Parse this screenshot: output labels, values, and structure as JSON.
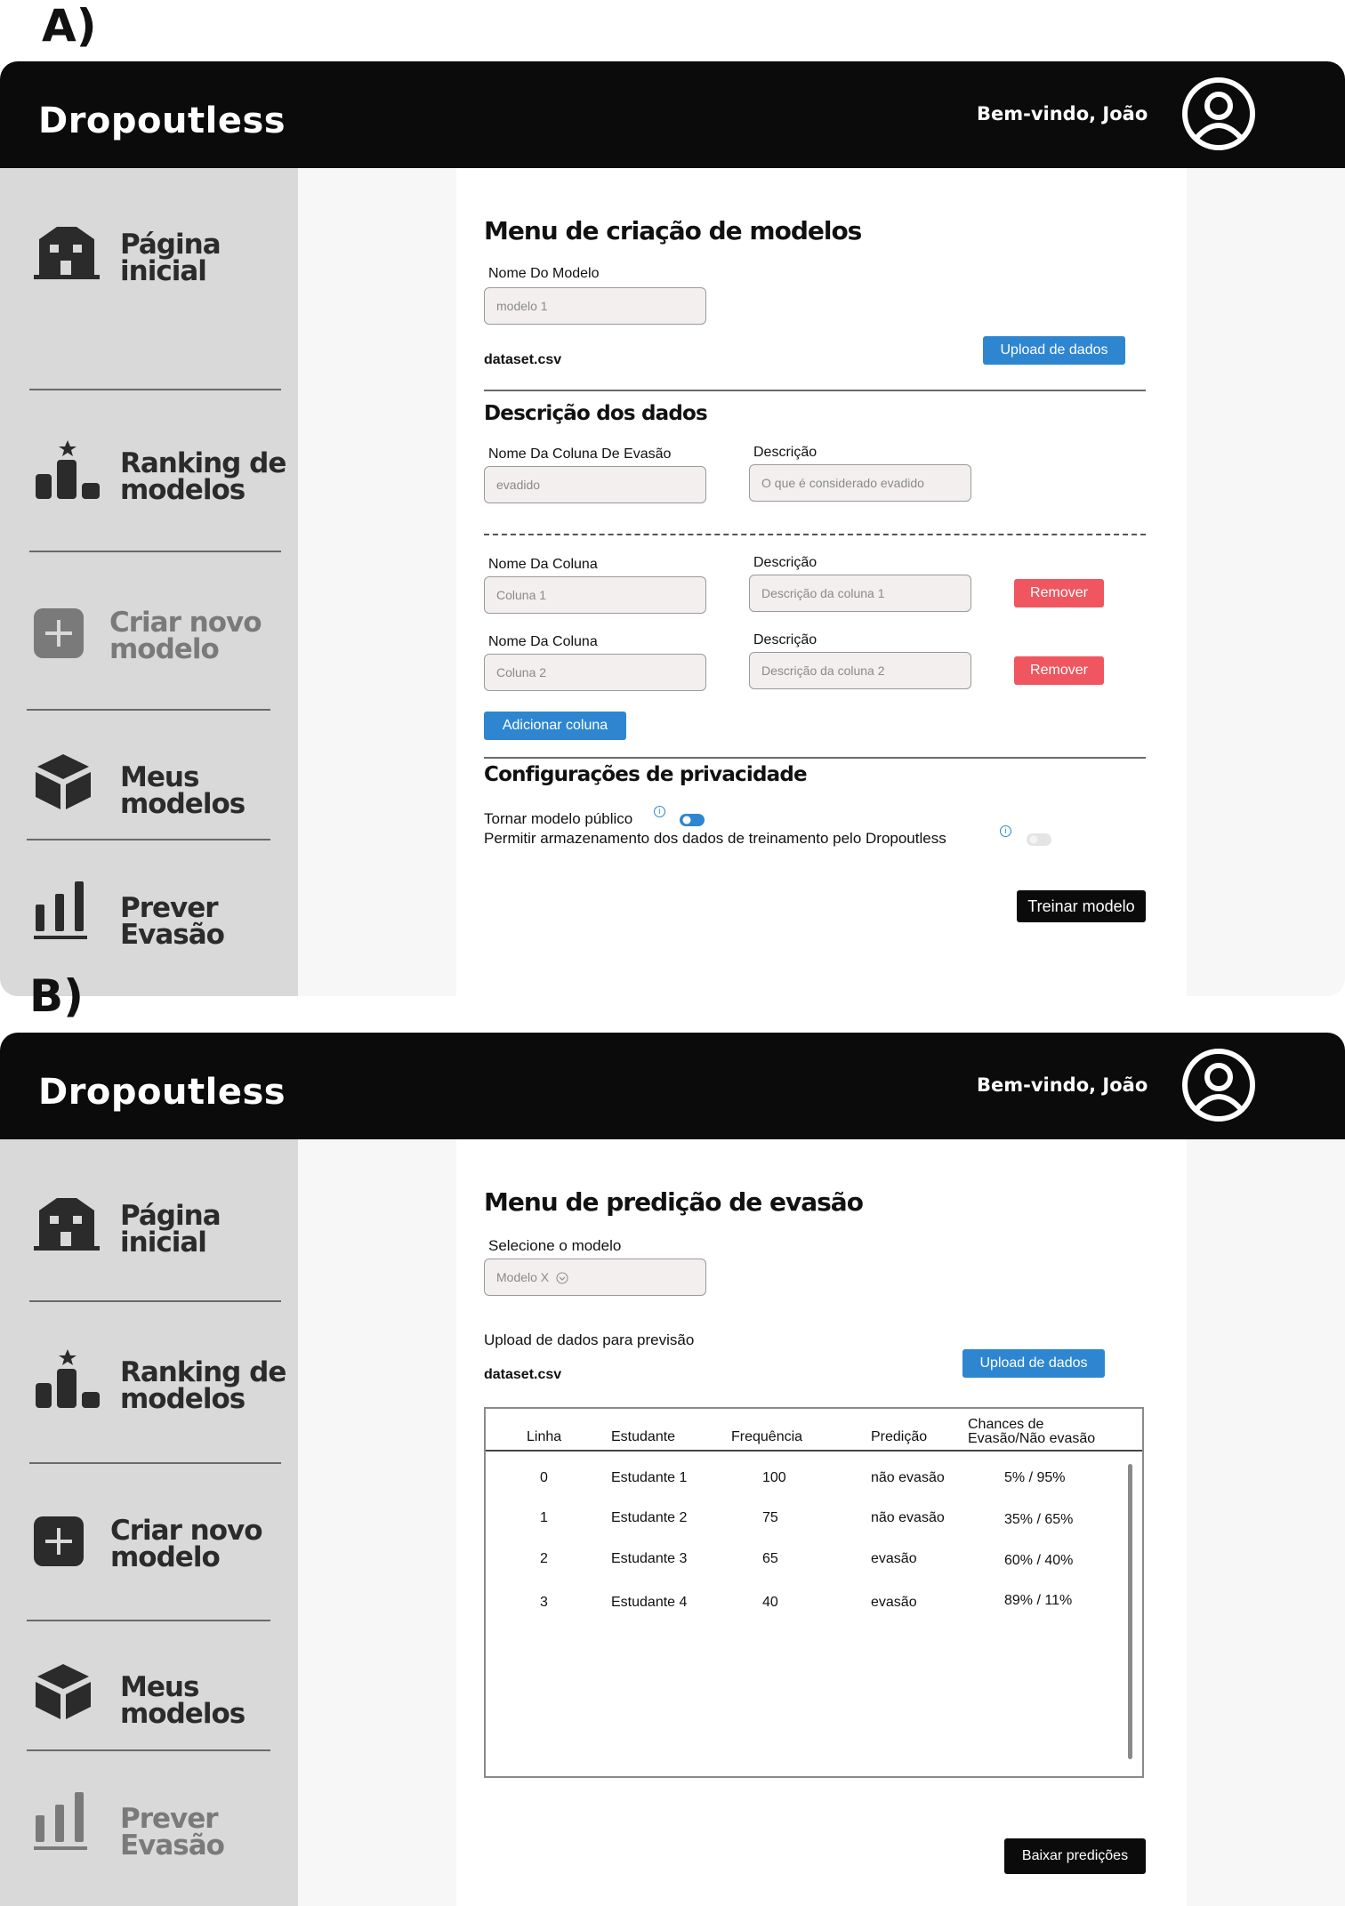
{
  "panel_a": {
    "label": "A)",
    "brand": "Dropoutless",
    "welcome": "Bem-vindo, João",
    "sidebar": [
      {
        "label": "Página inicial",
        "icon": "home-icon"
      },
      {
        "label": "Ranking de modelos",
        "icon": "podium-icon"
      },
      {
        "label": "Criar novo modelo",
        "icon": "plus-icon"
      },
      {
        "label": "Meus modelos",
        "icon": "cube-icon"
      },
      {
        "label": "Prever Evasão",
        "icon": "bar-chart-icon"
      }
    ],
    "title": "Menu de criação de modelos",
    "model_name_label": "Nome Do Modelo",
    "model_name_placeholder": "modelo 1",
    "file_name": "dataset.csv",
    "upload_button": "Upload de dados",
    "data_section_title": "Descrição dos dados",
    "dropout_col_label": "Nome Da Coluna De Evasão",
    "dropout_col_placeholder": "evadido",
    "description_label": "Descrição",
    "dropout_desc_placeholder": "O que é considerado evadido",
    "columns": [
      {
        "name_label": "Nome Da Coluna",
        "name_placeholder": "Coluna 1",
        "desc_label": "Descrição",
        "desc_placeholder": "Descrição da coluna 1",
        "remove": "Remover"
      },
      {
        "name_label": "Nome Da Coluna",
        "name_placeholder": "Coluna 2",
        "desc_label": "Descrição",
        "desc_placeholder": "Descrição da coluna 2",
        "remove": "Remover"
      }
    ],
    "add_column_button": "Adicionar coluna",
    "privacy_title": "Configurações de privacidade",
    "public_toggle_label": "Tornar modelo público",
    "public_toggle_on": true,
    "storage_toggle_label": "Permitir armazenamento dos dados de treinamento pelo Dropoutless",
    "storage_toggle_on": false,
    "info_glyph": "i",
    "train_button": "Treinar modelo"
  },
  "panel_b": {
    "label": "B)",
    "brand": "Dropoutless",
    "welcome": "Bem-vindo, João",
    "sidebar": [
      {
        "label": "Página inicial",
        "icon": "home-icon"
      },
      {
        "label": "Ranking de modelos",
        "icon": "podium-icon"
      },
      {
        "label": "Criar novo modelo",
        "icon": "plus-icon"
      },
      {
        "label": "Meus modelos",
        "icon": "cube-icon"
      },
      {
        "label": "Prever Evasão",
        "icon": "bar-chart-icon"
      }
    ],
    "title": "Menu de predição de evasão",
    "select_model_label": "Selecione o modelo",
    "select_model_value": "Modelo X",
    "upload_section_label": "Upload de dados para previsão",
    "file_name": "dataset.csv",
    "upload_button": "Upload de dados",
    "table": {
      "headers": [
        "Linha",
        "Estudante",
        "Frequência",
        "Predição",
        "Chances de",
        "Evasão/Não evasão"
      ],
      "rows": [
        [
          "0",
          "Estudante 1",
          "100",
          "não evasão",
          "5% / 95%"
        ],
        [
          "1",
          "Estudante 2",
          "75",
          "não evasão",
          "35% / 65%"
        ],
        [
          "2",
          "Estudante 3",
          "65",
          "evasão",
          "60% / 40%"
        ],
        [
          "3",
          "Estudante 4",
          "40",
          "evasão",
          "89% / 11%"
        ]
      ]
    },
    "download_button": "Baixar predições"
  },
  "colors": {
    "topbar": "#0b0b0b",
    "sidebar": "#d9d9d9",
    "accent": "#2e86d0",
    "danger": "#f0565f"
  }
}
